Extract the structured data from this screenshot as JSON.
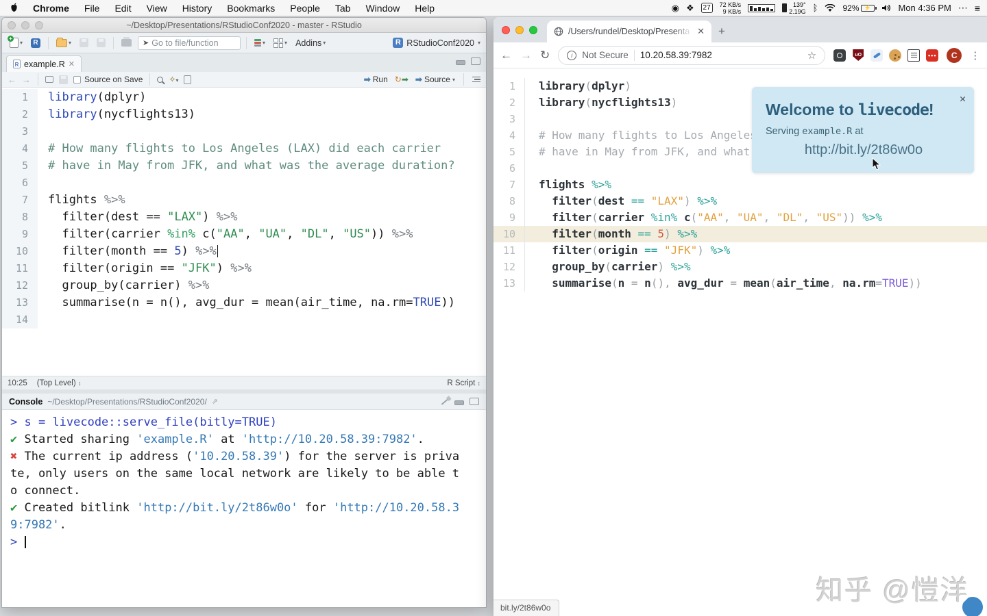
{
  "menu_bar": {
    "app": "Chrome",
    "items": [
      "File",
      "Edit",
      "View",
      "History",
      "Bookmarks",
      "People",
      "Tab",
      "Window",
      "Help"
    ],
    "status": {
      "calendar_day": "27",
      "net_up": "72 KB/s",
      "net_down": "9 KB/s",
      "temp": "139°",
      "data_rate": "2.19G",
      "bluetooth_glyph": "ᛒ",
      "battery_pct": "92%",
      "clock": "Mon 4:36 PM",
      "more_glyph": "⋯",
      "list_glyph": "≡"
    }
  },
  "rstudio": {
    "window_title": "~/Desktop/Presentations/RStudioConf2020 - master - RStudio",
    "toolbar": {
      "goto_placeholder": "Go to file/function",
      "addins_label": "Addins",
      "project_label": "RStudioConf2020"
    },
    "editor": {
      "tab_title": "example.R",
      "tab_close_glyph": "✕",
      "source_on_save_label": "Source on Save",
      "run_label": "Run",
      "source_label": "Source",
      "run_arrow_glyph": "➡",
      "status_position": "10:25",
      "status_scope": "(Top Level)",
      "status_updown_glyph": "↕",
      "status_type": "R Script"
    },
    "console": {
      "title": "Console",
      "path": "~/Desktop/Presentations/RStudioConf2020/",
      "lines": [
        {
          "tokens": [
            [
              "> s = livecode::serve_file(bitly=TRUE)",
              "cmd"
            ]
          ]
        },
        {
          "tokens": [
            [
              "✔ ",
              "ok"
            ],
            [
              "Started sharing ",
              "t"
            ],
            [
              "'example.R'",
              "q"
            ],
            [
              " at ",
              "t"
            ],
            [
              "'http://10.20.58.39:7982'",
              "q"
            ],
            [
              ".",
              "t"
            ]
          ]
        },
        {
          "tokens": [
            [
              "✖ ",
              "err"
            ],
            [
              "The current ip address (",
              "t"
            ],
            [
              "'10.20.58.39'",
              "q"
            ],
            [
              ") for the server is priva",
              "t"
            ]
          ]
        },
        {
          "tokens": [
            [
              "te, only users on the same local network are likely to be able t",
              "t"
            ]
          ]
        },
        {
          "tokens": [
            [
              "o connect.",
              "t"
            ]
          ]
        },
        {
          "tokens": [
            [
              "✔ ",
              "ok"
            ],
            [
              "Created bitlink ",
              "t"
            ],
            [
              "'http://bit.ly/2t86w0o'",
              "q"
            ],
            [
              " for ",
              "t"
            ],
            [
              "'http://10.20.58.3",
              "q"
            ]
          ]
        },
        {
          "tokens": [
            [
              "9:7982'",
              "q"
            ],
            [
              ".",
              "t"
            ]
          ]
        },
        {
          "tokens": [
            [
              "> ",
              "prompt"
            ]
          ],
          "caret": true
        }
      ]
    }
  },
  "code": {
    "rstudio_visible_lines": 14,
    "browser_visible_lines": 13,
    "cursor_line": 10,
    "highlight_line": 10,
    "lines": [
      {
        "n": 1,
        "tokens": [
          [
            "library",
            "kw"
          ],
          [
            "(",
            "p"
          ],
          [
            "dplyr",
            "id"
          ],
          [
            ")",
            "p"
          ]
        ]
      },
      {
        "n": 2,
        "tokens": [
          [
            "library",
            "kw"
          ],
          [
            "(",
            "p"
          ],
          [
            "nycflights13",
            "id"
          ],
          [
            ")",
            "p"
          ]
        ]
      },
      {
        "n": 3,
        "tokens": []
      },
      {
        "n": 4,
        "tokens": [
          [
            "# How many flights to Los Angeles (LAX) did each carrier",
            "com"
          ]
        ]
      },
      {
        "n": 5,
        "tokens": [
          [
            "# have in May from JFK, and what was the average duration?",
            "com"
          ]
        ]
      },
      {
        "n": 6,
        "tokens": []
      },
      {
        "n": 7,
        "tokens": [
          [
            "flights",
            "id"
          ],
          [
            " ",
            "p"
          ],
          [
            "%>%",
            "pipe"
          ]
        ]
      },
      {
        "n": 8,
        "tokens": [
          [
            "  ",
            "p"
          ],
          [
            "filter",
            "id"
          ],
          [
            "(",
            "p"
          ],
          [
            "dest",
            "id"
          ],
          [
            " ",
            "p"
          ],
          [
            "==",
            "op"
          ],
          [
            " ",
            "p"
          ],
          [
            "\"LAX\"",
            "str"
          ],
          [
            ")",
            "p"
          ],
          [
            " ",
            "p"
          ],
          [
            "%>%",
            "pipe"
          ]
        ]
      },
      {
        "n": 9,
        "tokens": [
          [
            "  ",
            "p"
          ],
          [
            "filter",
            "id"
          ],
          [
            "(",
            "p"
          ],
          [
            "carrier",
            "id"
          ],
          [
            " ",
            "p"
          ],
          [
            "%in%",
            "inop"
          ],
          [
            " ",
            "p"
          ],
          [
            "c",
            "id"
          ],
          [
            "(",
            "p"
          ],
          [
            "\"AA\"",
            "str"
          ],
          [
            ", ",
            "p"
          ],
          [
            "\"UA\"",
            "str"
          ],
          [
            ", ",
            "p"
          ],
          [
            "\"DL\"",
            "str"
          ],
          [
            ", ",
            "p"
          ],
          [
            "\"US\"",
            "str"
          ],
          [
            "))",
            "p"
          ],
          [
            " ",
            "p"
          ],
          [
            "%>%",
            "pipe"
          ]
        ]
      },
      {
        "n": 10,
        "tokens": [
          [
            "  ",
            "p"
          ],
          [
            "filter",
            "id"
          ],
          [
            "(",
            "p"
          ],
          [
            "month",
            "id"
          ],
          [
            " ",
            "p"
          ],
          [
            "==",
            "op"
          ],
          [
            " ",
            "p"
          ],
          [
            "5",
            "num"
          ],
          [
            ")",
            "p"
          ],
          [
            " ",
            "p"
          ],
          [
            "%>%",
            "pipe"
          ]
        ]
      },
      {
        "n": 11,
        "tokens": [
          [
            "  ",
            "p"
          ],
          [
            "filter",
            "id"
          ],
          [
            "(",
            "p"
          ],
          [
            "origin",
            "id"
          ],
          [
            " ",
            "p"
          ],
          [
            "==",
            "op"
          ],
          [
            " ",
            "p"
          ],
          [
            "\"JFK\"",
            "str"
          ],
          [
            ")",
            "p"
          ],
          [
            " ",
            "p"
          ],
          [
            "%>%",
            "pipe"
          ]
        ]
      },
      {
        "n": 12,
        "tokens": [
          [
            "  ",
            "p"
          ],
          [
            "group_by",
            "id"
          ],
          [
            "(",
            "p"
          ],
          [
            "carrier",
            "id"
          ],
          [
            ")",
            "p"
          ],
          [
            " ",
            "p"
          ],
          [
            "%>%",
            "pipe"
          ]
        ]
      },
      {
        "n": 13,
        "tokens": [
          [
            "  ",
            "p"
          ],
          [
            "summarise",
            "id"
          ],
          [
            "(",
            "p"
          ],
          [
            "n",
            "id"
          ],
          [
            " ",
            "p"
          ],
          [
            "=",
            "eq"
          ],
          [
            " ",
            "p"
          ],
          [
            "n",
            "id"
          ],
          [
            "()",
            "p"
          ],
          [
            ", ",
            "p"
          ],
          [
            "avg_dur",
            "id"
          ],
          [
            " ",
            "p"
          ],
          [
            "=",
            "eq"
          ],
          [
            " ",
            "p"
          ],
          [
            "mean",
            "id"
          ],
          [
            "(",
            "p"
          ],
          [
            "air_time",
            "id"
          ],
          [
            ", ",
            "p"
          ],
          [
            "na.rm",
            "id"
          ],
          [
            "=",
            "eq"
          ],
          [
            "TRUE",
            "bool"
          ],
          [
            "))",
            "p"
          ]
        ]
      },
      {
        "n": 14,
        "tokens": []
      }
    ]
  },
  "chrome": {
    "tab_title": "/Users/rundel/Desktop/Presenta",
    "tab_close_glyph": "✕",
    "new_tab_glyph": "+",
    "back_glyph": "←",
    "forward_glyph": "→",
    "reload_glyph": "↻",
    "security_label": "Not Secure",
    "url": "10.20.58.39:7982",
    "star_glyph": "☆",
    "ublock_label": "uO",
    "redbox_label": "•••",
    "avatar_letter": "C",
    "kebab_glyph": "⋮",
    "popup": {
      "close_glyph": "✕",
      "title_prefix": "Welcome to ",
      "title_code": "livecode",
      "title_suffix": "!",
      "serving_prefix": "Serving ",
      "serving_file": "example.R",
      "serving_suffix": " at",
      "link": "http://bit.ly/2t86w0o"
    },
    "status_bubble": "bit.ly/2t86w0o"
  },
  "watermark": {
    "text": "知乎 @愷洋"
  },
  "colors": {
    "popup_bg": "#cfe8f4",
    "popup_title": "#2d5f7d",
    "popup_link": "#4a7187",
    "browser_highlight_row": "#f2eddc",
    "rstudio_keyword": "#2f4bb5",
    "rstudio_string": "#2e8b4f",
    "rstudio_comment": "#5f8c80",
    "browser_string": "#e2a13d",
    "browser_operator": "#2aa198",
    "browser_number": "#c75b44",
    "browser_bool": "#7c5cd6",
    "console_command": "#2e3fbf",
    "console_success": "#259b3e",
    "console_error": "#d64541",
    "console_quote": "#3579b5"
  }
}
